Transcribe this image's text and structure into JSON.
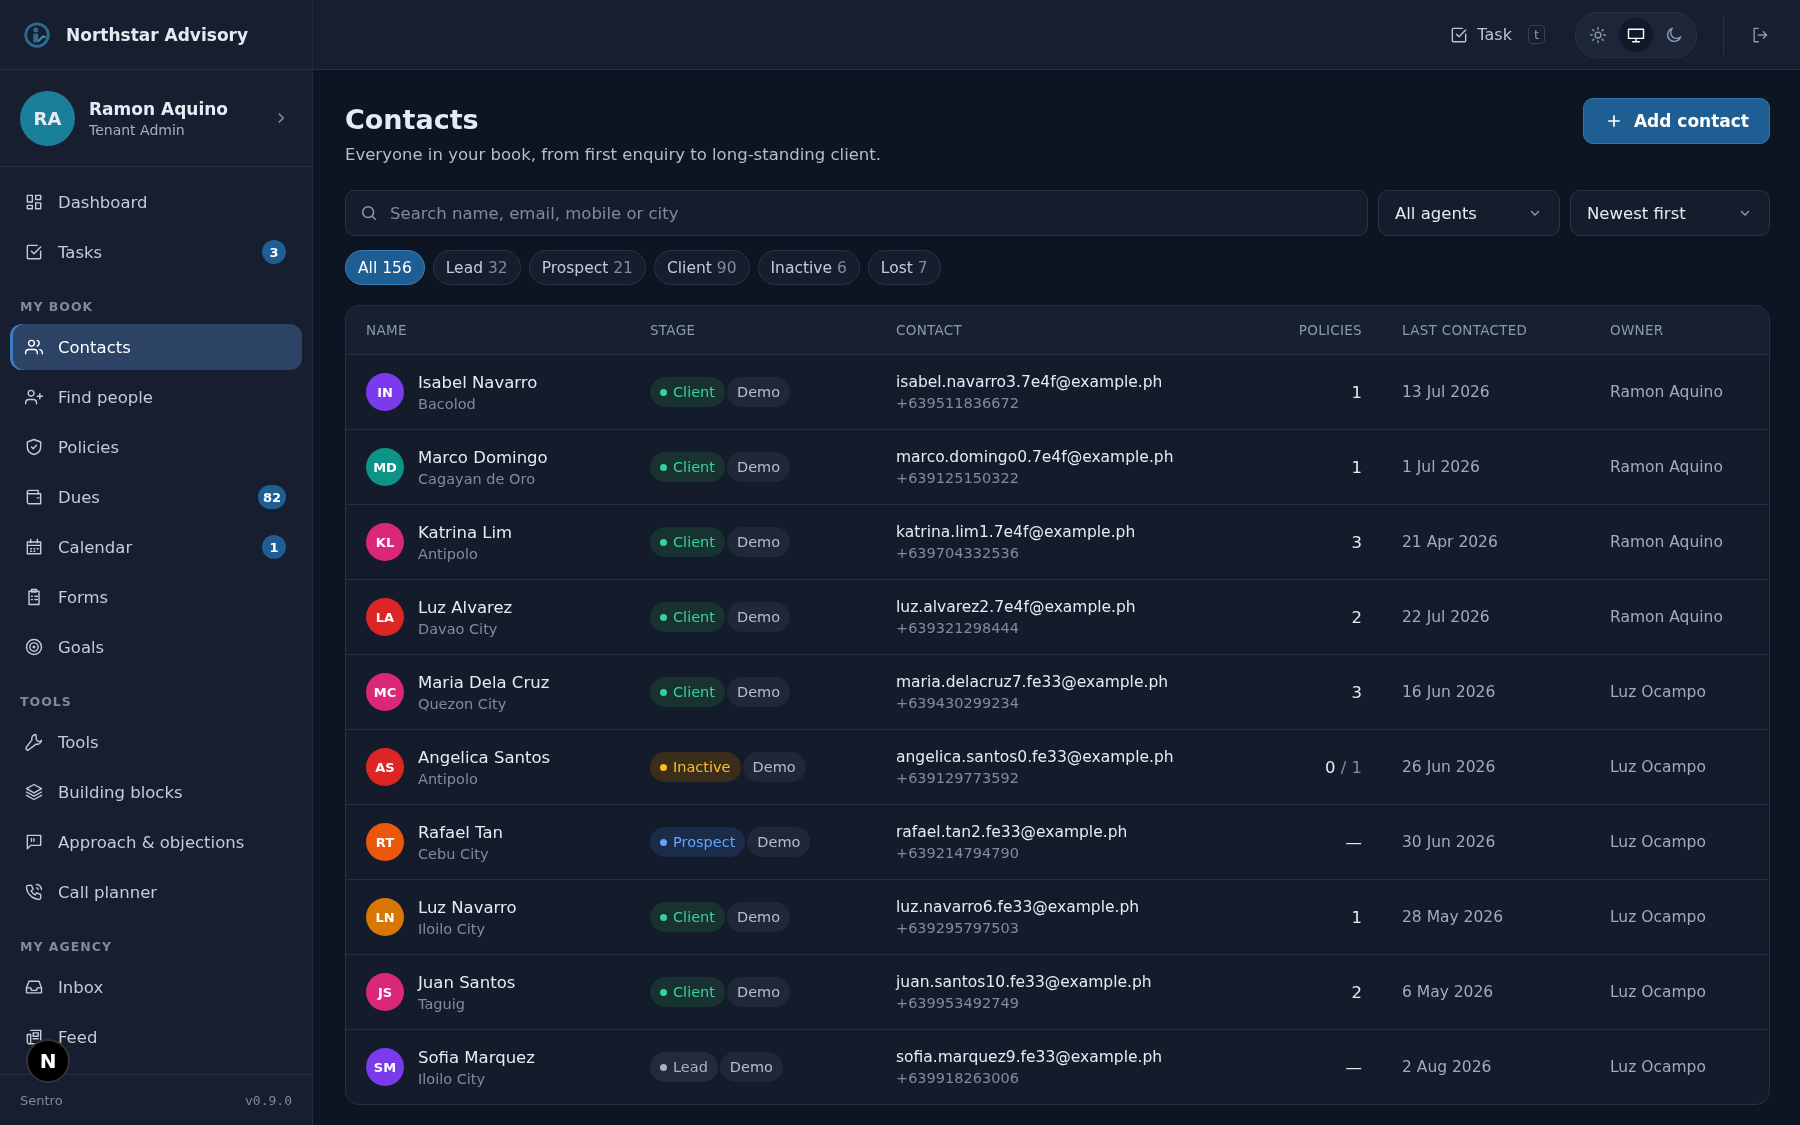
{
  "brand": {
    "name": "Northstar Advisory"
  },
  "user": {
    "initials": "RA",
    "name": "Ramon Aquino",
    "role": "Tenant Admin"
  },
  "nav": [
    {
      "items": [
        {
          "label": "Dashboard",
          "selected": false
        },
        {
          "label": "Tasks",
          "selected": false,
          "badge": "3"
        }
      ]
    },
    {
      "heading": "MY BOOK",
      "items": [
        {
          "label": "Contacts",
          "selected": true
        },
        {
          "label": "Find people",
          "selected": false
        },
        {
          "label": "Policies",
          "selected": false
        },
        {
          "label": "Dues",
          "selected": false,
          "badge": "82"
        },
        {
          "label": "Calendar",
          "selected": false,
          "badge": "1"
        },
        {
          "label": "Forms",
          "selected": false
        },
        {
          "label": "Goals",
          "selected": false
        }
      ]
    },
    {
      "heading": "TOOLS",
      "items": [
        {
          "label": "Tools",
          "selected": false
        },
        {
          "label": "Building blocks",
          "selected": false
        },
        {
          "label": "Approach & objections",
          "selected": false
        },
        {
          "label": "Call planner",
          "selected": false
        }
      ]
    },
    {
      "heading": "MY AGENCY",
      "items": [
        {
          "label": "Inbox",
          "selected": false
        },
        {
          "label": "Feed",
          "selected": false
        }
      ]
    }
  ],
  "footer": {
    "app": "Sentro",
    "version": "v0.9.0",
    "dev_badge": "N"
  },
  "topbar": {
    "task_button": "Task",
    "task_shortcut": "t",
    "theme_switch": [
      {
        "selected": false
      },
      {
        "selected": true
      },
      {
        "selected": false
      }
    ]
  },
  "page": {
    "title": "Contacts",
    "subtitle": "Everyone in your book, from first enquiry to long-standing client.",
    "add_button": "Add contact"
  },
  "search": {
    "placeholder": "Search name, email, mobile or city"
  },
  "agent_filter": "All agents",
  "sort": "Newest first",
  "stage_filters": [
    {
      "label": "All",
      "count": "156",
      "selected": true
    },
    {
      "label": "Lead",
      "count": "32",
      "selected": false
    },
    {
      "label": "Prospect",
      "count": "21",
      "selected": false
    },
    {
      "label": "Client",
      "count": "90",
      "selected": false
    },
    {
      "label": "Inactive",
      "count": "6",
      "selected": false
    },
    {
      "label": "Lost",
      "count": "7",
      "selected": false
    }
  ],
  "table": {
    "columns": [
      "NAME",
      "STAGE",
      "CONTACT",
      "POLICIES",
      "LAST CONTACTED",
      "OWNER"
    ],
    "rows": [
      {
        "initials": "IN",
        "color": "#7c3aed",
        "name": "Isabel Navarro",
        "city": "Bacolod",
        "stage": "Client",
        "kind": "client",
        "tag": "Demo",
        "email": "isabel.navarro3.7e4f@example.ph",
        "mobile": "+639511836672",
        "policies": "1",
        "last_contacted": "13 Jul 2026",
        "owner": "Ramon Aquino"
      },
      {
        "initials": "MD",
        "color": "#0d9488",
        "name": "Marco Domingo",
        "city": "Cagayan de Oro",
        "stage": "Client",
        "kind": "client",
        "tag": "Demo",
        "email": "marco.domingo0.7e4f@example.ph",
        "mobile": "+639125150322",
        "policies": "1",
        "last_contacted": "1 Jul 2026",
        "owner": "Ramon Aquino"
      },
      {
        "initials": "KL",
        "color": "#db2777",
        "name": "Katrina Lim",
        "city": "Antipolo",
        "stage": "Client",
        "kind": "client",
        "tag": "Demo",
        "email": "katrina.lim1.7e4f@example.ph",
        "mobile": "+639704332536",
        "policies": "3",
        "last_contacted": "21 Apr 2026",
        "owner": "Ramon Aquino"
      },
      {
        "initials": "LA",
        "color": "#dc2626",
        "name": "Luz Alvarez",
        "city": "Davao City",
        "stage": "Client",
        "kind": "client",
        "tag": "Demo",
        "email": "luz.alvarez2.7e4f@example.ph",
        "mobile": "+639321298444",
        "policies": "2",
        "last_contacted": "22 Jul 2026",
        "owner": "Ramon Aquino"
      },
      {
        "initials": "MC",
        "color": "#db2777",
        "name": "Maria Dela Cruz",
        "city": "Quezon City",
        "stage": "Client",
        "kind": "client",
        "tag": "Demo",
        "email": "maria.delacruz7.fe33@example.ph",
        "mobile": "+639430299234",
        "policies": "3",
        "last_contacted": "16 Jun 2026",
        "owner": "Luz Ocampo"
      },
      {
        "initials": "AS",
        "color": "#dc2626",
        "name": "Angelica Santos",
        "city": "Antipolo",
        "stage": "Inactive",
        "kind": "inactive",
        "tag": "Demo",
        "email": "angelica.santos0.fe33@example.ph",
        "mobile": "+639129773592",
        "policies": "0",
        "policies_total": "/ 1",
        "last_contacted": "26 Jun 2026",
        "owner": "Luz Ocampo"
      },
      {
        "initials": "RT",
        "color": "#ea580c",
        "name": "Rafael Tan",
        "city": "Cebu City",
        "stage": "Prospect",
        "kind": "prospect",
        "tag": "Demo",
        "email": "rafael.tan2.fe33@example.ph",
        "mobile": "+639214794790",
        "policies": "—",
        "last_contacted": "30 Jun 2026",
        "owner": "Luz Ocampo"
      },
      {
        "initials": "LN",
        "color": "#d97706",
        "name": "Luz Navarro",
        "city": "Iloilo City",
        "stage": "Client",
        "kind": "client",
        "tag": "Demo",
        "email": "luz.navarro6.fe33@example.ph",
        "mobile": "+639295797503",
        "policies": "1",
        "last_contacted": "28 May 2026",
        "owner": "Luz Ocampo"
      },
      {
        "initials": "JS",
        "color": "#db2777",
        "name": "Juan Santos",
        "city": "Taguig",
        "stage": "Client",
        "kind": "client",
        "tag": "Demo",
        "email": "juan.santos10.fe33@example.ph",
        "mobile": "+639953492749",
        "policies": "2",
        "last_contacted": "6 May 2026",
        "owner": "Luz Ocampo"
      },
      {
        "initials": "SM",
        "color": "#7c3aed",
        "name": "Sofia Marquez",
        "city": "Iloilo City",
        "stage": "Lead",
        "kind": "lead",
        "tag": "Demo",
        "email": "sofia.marquez9.fe33@example.ph",
        "mobile": "+639918263006",
        "policies": "—",
        "last_contacted": "2 Aug 2026",
        "owner": "Luz Ocampo"
      }
    ]
  }
}
